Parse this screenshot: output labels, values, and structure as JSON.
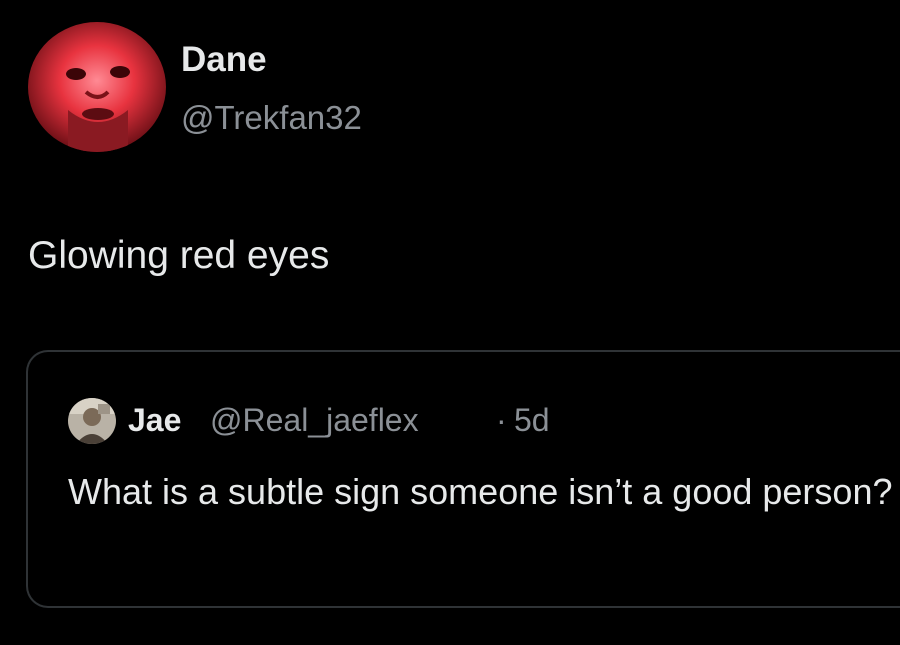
{
  "tweet": {
    "author": {
      "display_name": "Dane",
      "handle": "@Trekfan32"
    },
    "text": "Glowing red eyes"
  },
  "quoted_tweet": {
    "author": {
      "display_name": "Jae",
      "handle": "@Real_jaeflex",
      "separator": "·",
      "time": "5d"
    },
    "text": "What is a subtle sign someone isn’t a good person?"
  },
  "colors": {
    "background": "#000000",
    "primary_text": "#e7e9ea",
    "secondary_text": "#8b9096",
    "border": "#2f3336",
    "avatar_glow": "#e8333f"
  },
  "icons": {
    "author_avatar": "avatar-red-glow",
    "quote_avatar": "avatar-photo"
  }
}
